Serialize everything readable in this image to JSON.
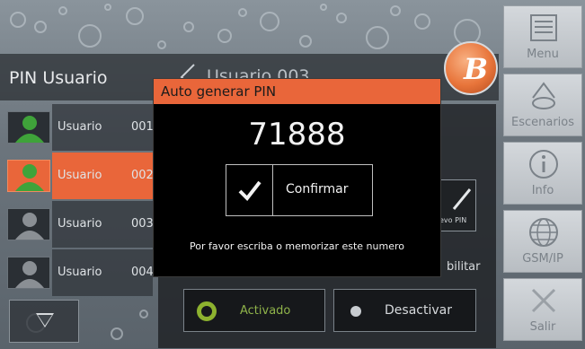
{
  "header": {
    "title": "PIN Usuario",
    "selected_user": "Usuario     003"
  },
  "users": [
    {
      "name": "Usuario",
      "number": "001",
      "avatar_color": "#3fa33a",
      "selected": false
    },
    {
      "name": "Usuario",
      "number": "002",
      "avatar_color": "#3fa33a",
      "selected": true
    },
    {
      "name": "Usuario",
      "number": "003",
      "avatar_color": "#8a8f94",
      "selected": false
    },
    {
      "name": "Usuario",
      "number": "004",
      "avatar_color": "#8a8f94",
      "selected": false
    }
  ],
  "panel": {
    "nuevo_pin_label": "evo PIN",
    "habilitar_label": "bilitar",
    "activado_label": "Activado",
    "desactivar_label": "Desactivar"
  },
  "sidebar": {
    "items": [
      {
        "label": "Menu",
        "icon": "menu-list-icon"
      },
      {
        "label": "Escenarios",
        "icon": "scenes-icon"
      },
      {
        "label": "Info",
        "icon": "info-icon"
      },
      {
        "label": "GSM/IP",
        "icon": "globe-icon"
      },
      {
        "label": "Salir",
        "icon": "exit-x-icon"
      }
    ]
  },
  "modal": {
    "title": "Auto generar PIN",
    "pin": "71888",
    "confirm_label": "Confirmar",
    "note": "Por favor escriba o memorizar este numero"
  },
  "colors": {
    "accent": "#e9663a",
    "active_green": "#8db22f"
  }
}
